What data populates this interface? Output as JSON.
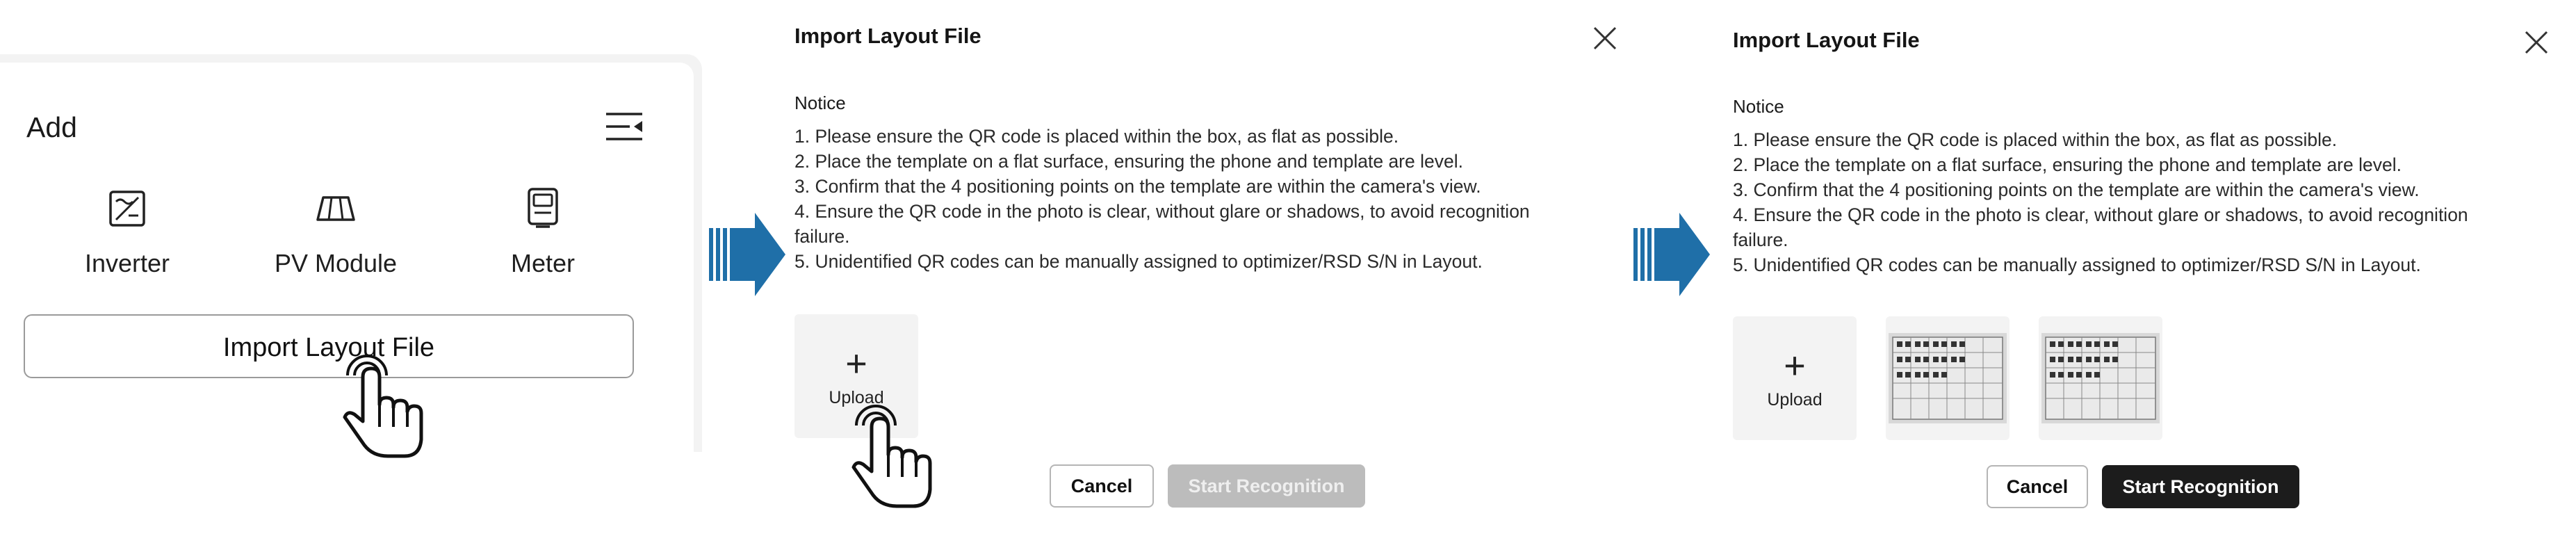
{
  "add_panel": {
    "title": "Add",
    "devices": [
      {
        "label": "Inverter",
        "icon": "inverter-icon"
      },
      {
        "label": "PV Module",
        "icon": "pv-module-icon"
      },
      {
        "label": "Meter",
        "icon": "meter-icon"
      }
    ],
    "import_button": "Import Layout File"
  },
  "dialog_step2": {
    "title": "Import Layout File",
    "notice_title": "Notice",
    "notices": [
      "1. Please ensure the QR code is placed within the box, as flat as possible.",
      "2. Place the template on a flat surface, ensuring the phone and template are level.",
      "3. Confirm that the 4 positioning points on the template are within the camera's view.",
      "4. Ensure the QR code in the photo is clear, without glare or shadows, to avoid recognition",
      "failure.",
      "5. Unidentified QR codes can be manually assigned to optimizer/RSD S/N in Layout."
    ],
    "upload_plus": "+",
    "upload_label": "Upload",
    "cancel_label": "Cancel",
    "start_label": "Start Recognition",
    "start_enabled": false
  },
  "dialog_step3": {
    "title": "Import Layout File",
    "notice_title": "Notice",
    "notices": [
      "1. Please ensure the QR code is placed within the box, as flat as possible.",
      "2. Place the template on a flat surface, ensuring the phone and template are level.",
      "3. Confirm that the 4 positioning points on the template are within the camera's view.",
      "4. Ensure the QR code in the photo is clear, without glare or shadows, to avoid recognition",
      "failure.",
      "5. Unidentified QR codes can be manually assigned to optimizer/RSD S/N in Layout."
    ],
    "upload_plus": "+",
    "upload_label": "Upload",
    "uploaded_images": 2,
    "cancel_label": "Cancel",
    "start_label": "Start Recognition",
    "start_enabled": true
  },
  "colors": {
    "arrow": "#1f6fa8",
    "primary_button": "#1c1c1c",
    "disabled_button": "#bcbcbc",
    "tile_background": "#f3f3f3"
  }
}
